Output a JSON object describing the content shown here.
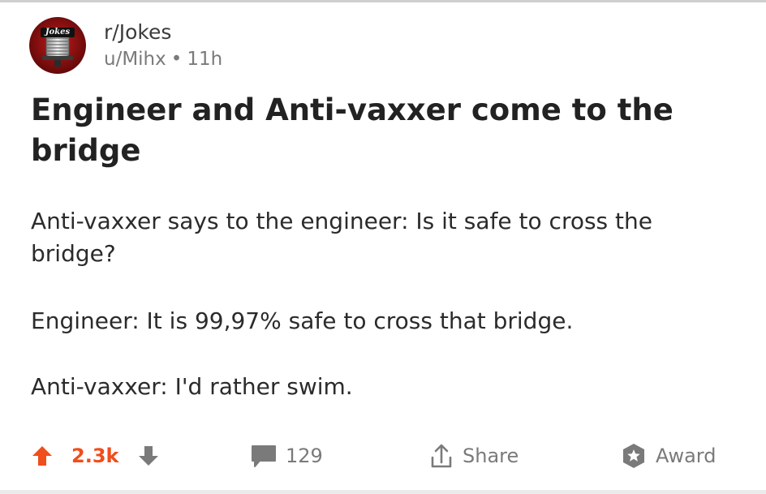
{
  "post": {
    "subreddit": "r/Jokes",
    "author": "u/Mihx",
    "separator": "•",
    "age": "11h",
    "title": "Engineer and Anti-vaxxer come to the bridge",
    "body": [
      "Anti-vaxxer says to the engineer: Is it safe to cross the bridge?",
      "Engineer: It is 99,97% safe to cross that bridge.",
      "Anti-vaxxer: I'd rather swim."
    ]
  },
  "avatar": {
    "logo_text": "Jokes",
    "icon": "microphone-icon"
  },
  "actions": {
    "score": "2.3k",
    "comments": "129",
    "share_label": "Share",
    "award_label": "Award"
  },
  "colors": {
    "upvote": "#f04e1b",
    "muted": "#7a7a7a",
    "text": "#222222",
    "avatar_bg": "#8b0d0d"
  }
}
